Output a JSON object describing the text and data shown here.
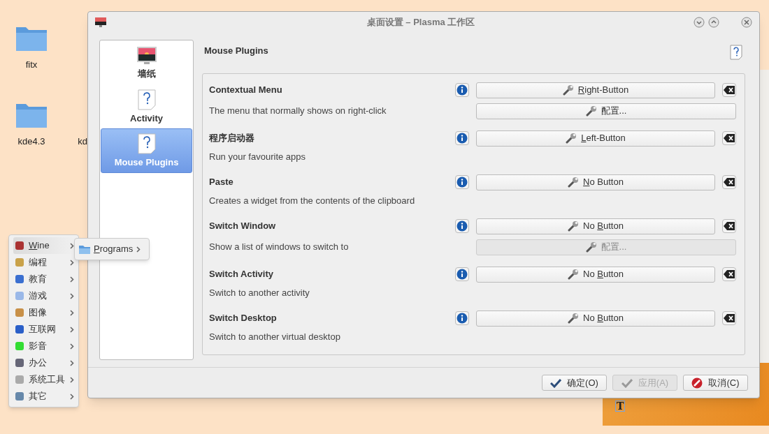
{
  "desktop": {
    "icons": [
      {
        "label": "fitx"
      },
      {
        "label": "kde4.3"
      },
      {
        "label": "kd"
      }
    ],
    "note": {
      "text": "T"
    }
  },
  "window": {
    "title": "桌面设置 – Plasma 工作区"
  },
  "sidebar": {
    "items": [
      {
        "label": "墙纸",
        "selected": false
      },
      {
        "label": "Activity",
        "selected": false
      },
      {
        "label": "Mouse Plugins",
        "selected": true
      }
    ]
  },
  "page": {
    "title": "Mouse Plugins",
    "plugins": [
      {
        "title": "Contextual Menu",
        "description": "The menu that normally shows on right-click",
        "trigger": {
          "key": "R",
          "after": "ight-Button"
        },
        "configure": {
          "label": "配置...",
          "disabled": false
        }
      },
      {
        "title": "程序启动器",
        "description": "Run your favourite apps",
        "trigger": {
          "key": "L",
          "after": "eft-Button"
        }
      },
      {
        "title": "Paste",
        "description": "Creates a widget from the contents of the clipboard",
        "trigger": {
          "key": "N",
          "after": "o Button"
        }
      },
      {
        "title": "Switch Window",
        "description": "Show a list of windows to switch to",
        "trigger": {
          "before": "No ",
          "key": "B",
          "after": "utton"
        },
        "configure": {
          "label": "配置...",
          "disabled": true
        }
      },
      {
        "title": "Switch Activity",
        "description": "Switch to another activity",
        "trigger": {
          "before": "No ",
          "key": "B",
          "after": "utton"
        }
      },
      {
        "title": "Switch Desktop",
        "description": "Switch to another virtual desktop",
        "trigger": {
          "before": "No ",
          "key": "B",
          "after": "utton"
        }
      }
    ]
  },
  "buttons": [
    {
      "kind": "ok",
      "label": "确定(O)",
      "disabled": false
    },
    {
      "kind": "apply",
      "label": "应用(A)",
      "disabled": true
    },
    {
      "kind": "cancel",
      "label": "取消(C)",
      "disabled": false
    }
  ],
  "menu": {
    "items": [
      {
        "label": "Wine",
        "selected": true
      },
      {
        "label": "编程",
        "selected": false
      },
      {
        "label": "教育",
        "selected": false
      },
      {
        "label": "游戏",
        "selected": false
      },
      {
        "label": "图像",
        "selected": false
      },
      {
        "label": "互联网",
        "selected": false
      },
      {
        "label": "影音",
        "selected": false
      },
      {
        "label": "办公",
        "selected": false
      },
      {
        "label": "系统工具",
        "selected": false
      },
      {
        "label": "其它",
        "selected": false
      }
    ],
    "submenu": {
      "items": [
        {
          "label": "Programs"
        }
      ]
    }
  }
}
